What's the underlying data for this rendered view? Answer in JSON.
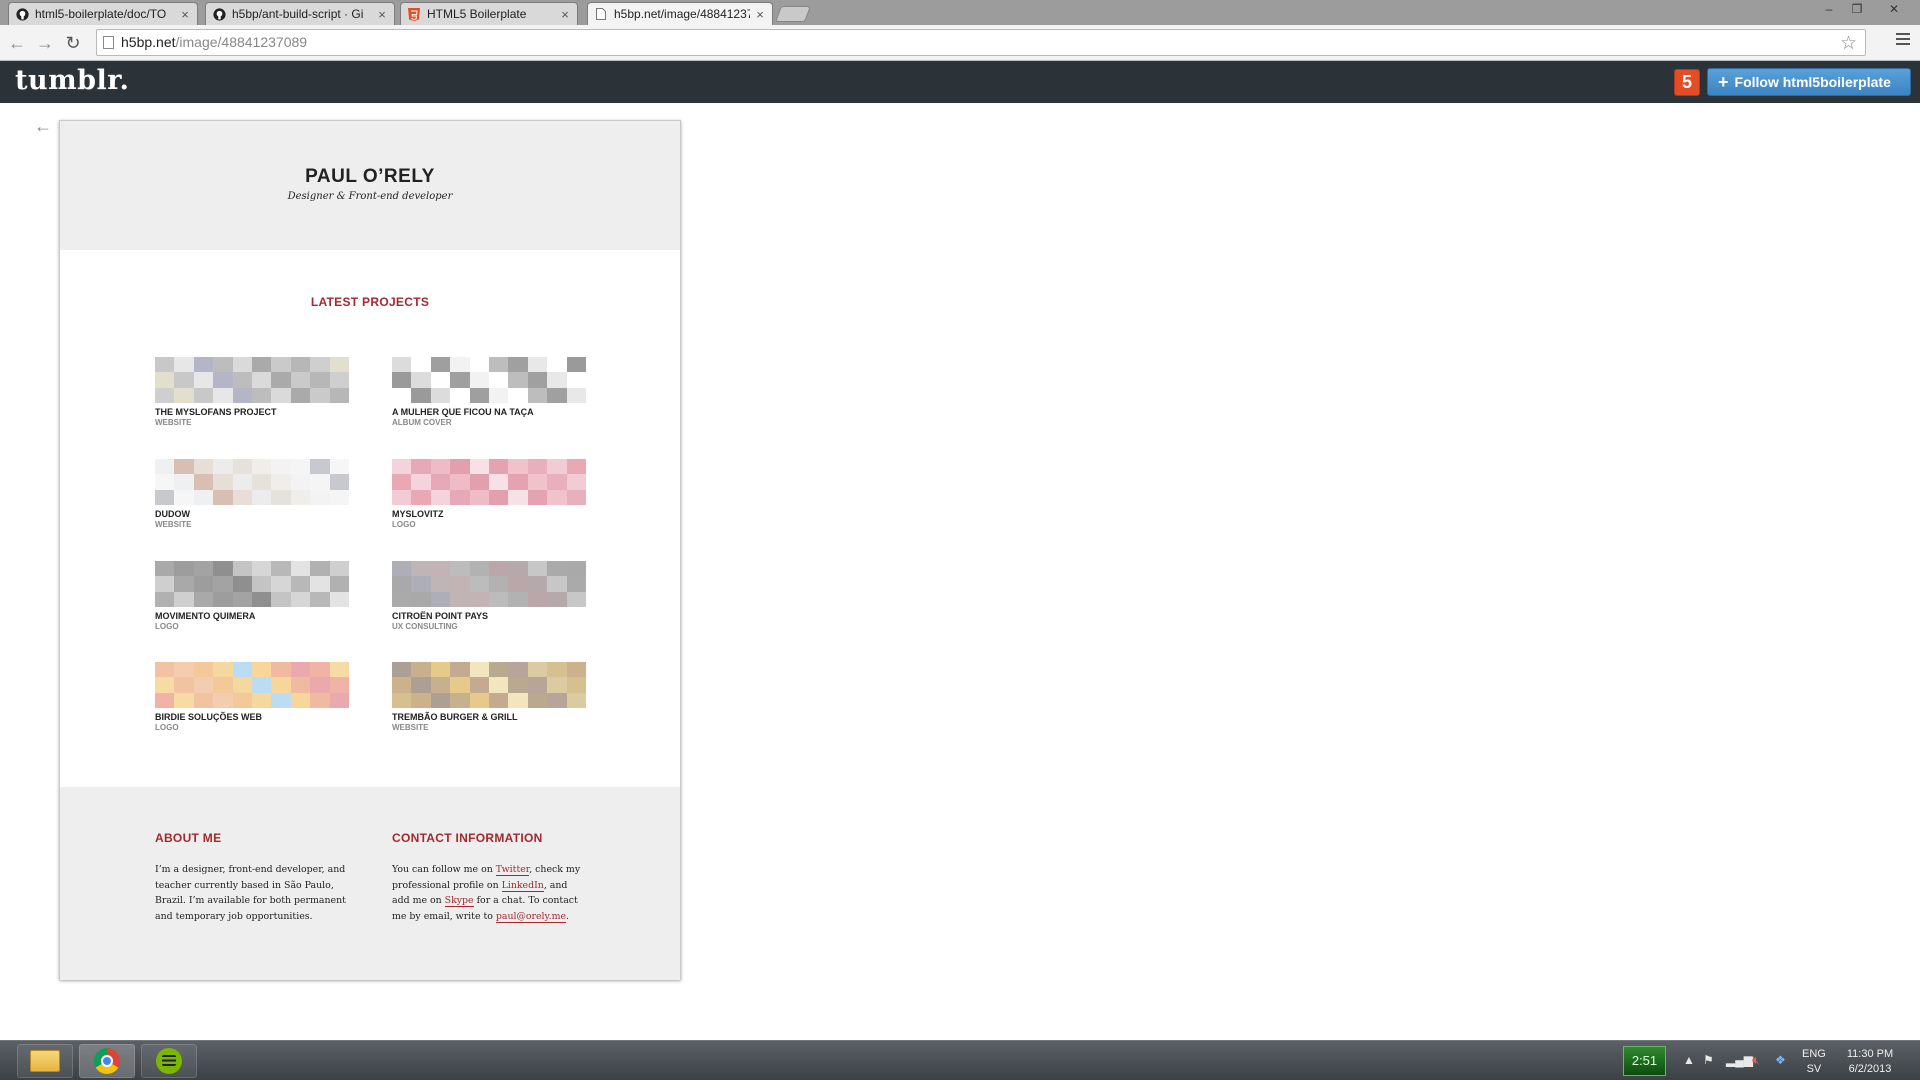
{
  "browser": {
    "tabs": [
      {
        "title": "html5-boilerplate/doc/TO",
        "icon": "github-icon",
        "active": false
      },
      {
        "title": "h5bp/ant-build-script · Gi",
        "icon": "github-icon",
        "active": false
      },
      {
        "title": "HTML5 Boilerplate",
        "icon": "html5-icon",
        "active": false
      },
      {
        "title": "h5bp.net/image/48841237",
        "icon": "page-icon",
        "active": true
      }
    ],
    "url_host": "h5bp.net",
    "url_path": "/image/48841237089"
  },
  "tumblr": {
    "logo": "tumblr.",
    "badge": "5",
    "follow_label": "Follow html5boilerplate"
  },
  "page": {
    "back_arrow": "←",
    "name": "PAUL O’RELY",
    "tagline": "Designer & Front-end developer",
    "latest_title": "LATEST PROJECTS",
    "projects": [
      {
        "title": "THE MYSLOFANS PROJECT",
        "type": "WEBSITE",
        "palette": [
          "#c8c8c8",
          "#b7b7b7",
          "#dadada",
          "#e7e7e7",
          "#cfcfcf",
          "#aaaaaa",
          "#b5b5c8",
          "#e2e0cc",
          "#cacaca",
          "#bdbdbd"
        ]
      },
      {
        "title": "A MULHER QUE FICOU NA TAÇA",
        "type": "ALBUM COVER",
        "palette": [
          "#f2f2f2",
          "#dcdcdc",
          "#e8e8e8",
          "#ffffff",
          "#ffffff",
          "#ffffff",
          "#bdbdbd",
          "#9f9f9f",
          "#9a9a9a",
          "#a0a0a0"
        ]
      },
      {
        "title": "DUDOW",
        "type": "WEBSITE",
        "palette": [
          "#f3f3f3",
          "#ececec",
          "#eef0f2",
          "#f5f5f5",
          "#e4e2da",
          "#d9bfb3",
          "#c8c8cf",
          "#f0eeea",
          "#e7dfd7",
          "#f6f6f6"
        ]
      },
      {
        "title": "MYSLOVITZ",
        "type": "LOGO",
        "palette": [
          "#e9a8b4",
          "#f0c2cc",
          "#e2a0ae",
          "#f4d4dc",
          "#e8b0bc",
          "#f7e0e6",
          "#e6a9b7",
          "#f2ccd4",
          "#e3a3b1",
          "#eebbc7"
        ]
      },
      {
        "title": "MOVIMENTO QUIMERA",
        "type": "LOGO",
        "palette": [
          "#a3a3a3",
          "#cfcfcf",
          "#b8b8b8",
          "#8f8f8f",
          "#a9a9a9",
          "#e3e3e3",
          "#c4c4c4",
          "#9d9d9d",
          "#b1b1b1",
          "#d6d6d6"
        ]
      },
      {
        "title": "CITROËN POINT PAYS",
        "type": "UX CONSULTING",
        "palette": [
          "#b9a7aa",
          "#c4b3b5",
          "#a9a9a9",
          "#b5a9ab",
          "#bcbcbc",
          "#aeaeb8",
          "#c7c7c7",
          "#b2b2b2",
          "#bfb5b5",
          "#aaaaaa"
        ]
      },
      {
        "title": "BIRDIE SOLUÇÕES WEB",
        "type": "LOGO",
        "palette": [
          "#f0b3a6",
          "#f6d69b",
          "#f3c99a",
          "#f6dca4",
          "#efba9f",
          "#f5d7a0",
          "#f1c3a2",
          "#e9a9ad",
          "#bcdcf3",
          "#f4ccb0"
        ]
      },
      {
        "title": "TREMBÃO BURGER & GRILL",
        "type": "WEBSITE",
        "palette": [
          "#c6b08e",
          "#d7c08f",
          "#b8a98f",
          "#e6ca8a",
          "#cdb18c",
          "#b9a49a",
          "#c3aa91",
          "#ad9f93",
          "#dccaa0",
          "#f3e6be"
        ]
      }
    ],
    "about": {
      "title": "ABOUT ME",
      "text": "I’m a designer, front-end developer, and teacher currently based in São Paulo, Brazil. I’m available for both permanent and temporary job opportunities."
    },
    "contact": {
      "title": "CONTACT INFORMATION",
      "p1": "You can follow me on ",
      "link_twitter": "Twitter",
      "p2": ", check my professional profile on ",
      "link_linkedin": "LinkedIn",
      "p3": ", and add me on ",
      "link_skype": "Skype",
      "p4": " for a chat. To contact me by email, write to ",
      "link_email": "paul@orely.me",
      "p5": "."
    }
  },
  "taskbar": {
    "timer": "2:51",
    "lang_top": "ENG",
    "lang_bottom": "SV",
    "time": "11:30 PM",
    "date": "6/2/2013"
  },
  "colors": {
    "accent": "#a12a2f",
    "tumblr_bar": "#2c3338",
    "follow_button": "#3c84c2",
    "html5_badge": "#e44d26"
  }
}
